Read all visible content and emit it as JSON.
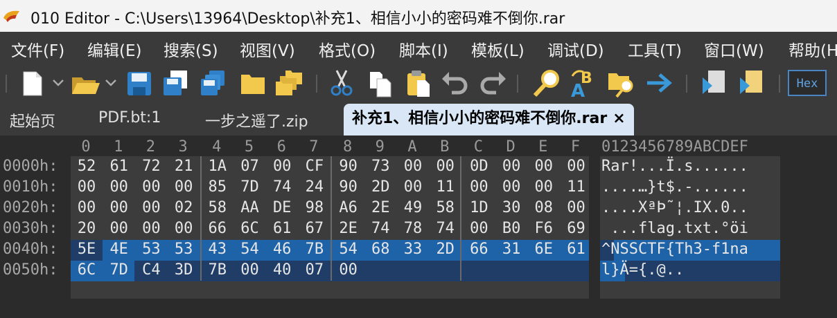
{
  "window": {
    "title": "010 Editor - C:\\Users\\13964\\Desktop\\补充1、相信小小的密码难不倒你.rar"
  },
  "menu": [
    "文件(F)",
    "编辑(E)",
    "搜索(S)",
    "视图(V)",
    "格式(O)",
    "脚本(I)",
    "模板(L)",
    "调试(D)",
    "工具(T)",
    "窗口(W)",
    "帮助(H"
  ],
  "toolbar": {
    "hex_label": "Hex"
  },
  "tabs": [
    {
      "label": "起始页"
    },
    {
      "label": "PDF.bt:1"
    },
    {
      "label": "一步之遥了.zip"
    },
    {
      "label": "补充1、相信小小的密码难不倒你.rar",
      "close": "×"
    }
  ],
  "hex": {
    "columns": [
      "0",
      "1",
      "2",
      "3",
      "4",
      "5",
      "6",
      "7",
      "8",
      "9",
      "A",
      "B",
      "C",
      "D",
      "E",
      "F"
    ],
    "ascii_header": "0123456789ABCDEF",
    "rows": [
      {
        "addr": "0000h:",
        "bytes": [
          "52",
          "61",
          "72",
          "21",
          "1A",
          "07",
          "00",
          "CF",
          "90",
          "73",
          "00",
          "00",
          "0D",
          "00",
          "00",
          "00"
        ],
        "ascii": "Rar!...Ï.s......"
      },
      {
        "addr": "0010h:",
        "bytes": [
          "00",
          "00",
          "00",
          "00",
          "85",
          "7D",
          "74",
          "24",
          "90",
          "2D",
          "00",
          "11",
          "00",
          "00",
          "00",
          "11"
        ],
        "ascii": "....…}t$.-......"
      },
      {
        "addr": "0020h:",
        "bytes": [
          "00",
          "00",
          "00",
          "02",
          "58",
          "AA",
          "DE",
          "98",
          "A6",
          "2E",
          "49",
          "58",
          "1D",
          "30",
          "08",
          "00"
        ],
        "ascii": "....XªÞ˜¦.IX.0.."
      },
      {
        "addr": "0030h:",
        "bytes": [
          "20",
          "00",
          "00",
          "00",
          "66",
          "6C",
          "61",
          "67",
          "2E",
          "74",
          "78",
          "74",
          "00",
          "B0",
          "F6",
          "69"
        ],
        "ascii": " ...flag.txt.°öi"
      },
      {
        "addr": "0040h:",
        "bytes": [
          "5E",
          "4E",
          "53",
          "53",
          "43",
          "54",
          "46",
          "7B",
          "54",
          "68",
          "33",
          "2D",
          "66",
          "31",
          "6E",
          "61"
        ],
        "ascii": "^NSSCTF{Th3-f1na"
      },
      {
        "addr": "0050h:",
        "bytes": [
          "6C",
          "7D",
          "C4",
          "3D",
          "7B",
          "00",
          "40",
          "07",
          "00"
        ],
        "ascii": "l}Ä={.@.."
      }
    ]
  }
}
